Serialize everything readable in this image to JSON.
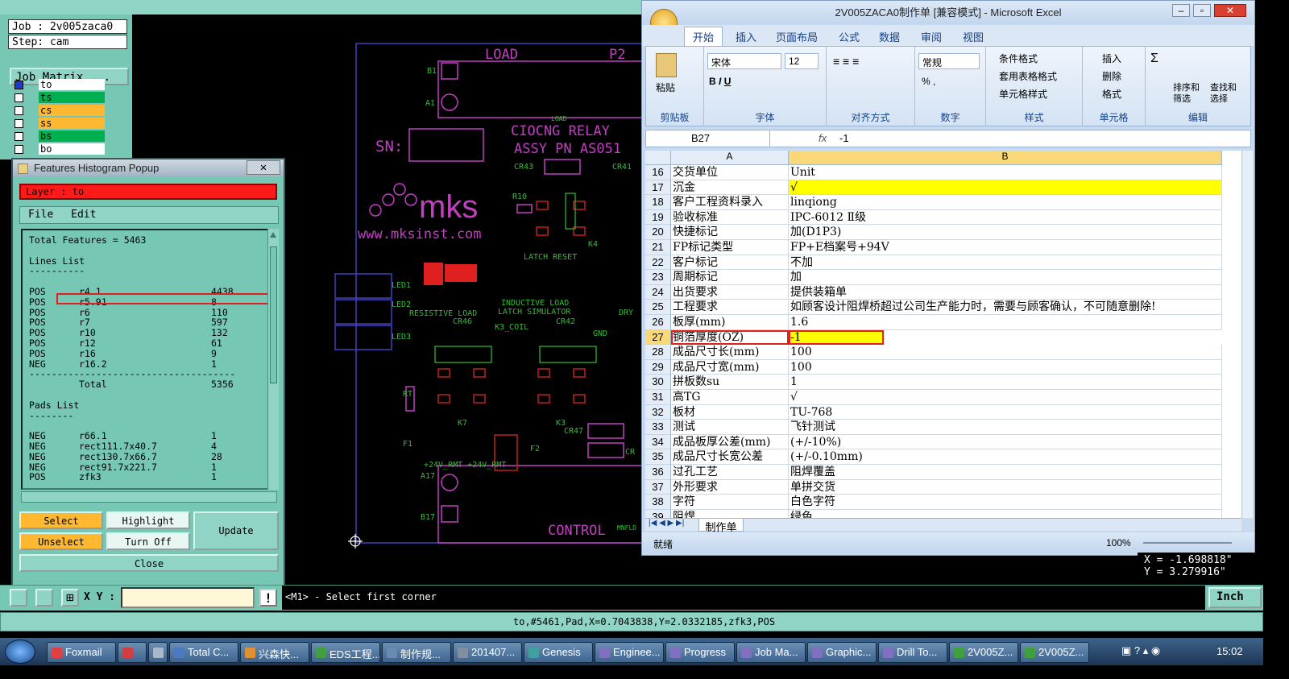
{
  "genesis": {
    "job_label": "Job : 2v005zaca0",
    "step_label": "Step: cam",
    "job_matrix_button": "Job Matrix ...",
    "layers": [
      {
        "name": "to",
        "color": "#ffffff",
        "active": true
      },
      {
        "name": "ts",
        "color": "#00b050"
      },
      {
        "name": "cs",
        "color": "#ffb830"
      },
      {
        "name": "ss",
        "color": "#ffb830"
      },
      {
        "name": "bs",
        "color": "#00b050"
      },
      {
        "name": "bo",
        "color": "#ffffff"
      }
    ],
    "pcb_text": {
      "load": "LOAD",
      "p2": "P2",
      "b1": "B1",
      "a1": "A1",
      "load_small": "LOAD",
      "relay1": "CIOCNG RELAY",
      "relay2": "ASSY PN AS051",
      "sn": "SN:",
      "cr43": "CR43",
      "cr41": "CR41",
      "r10": "R10",
      "k4": "K4",
      "latch_reset": "LATCH RESET",
      "mks": "mks",
      "url": "www.mksinst.com",
      "led1": "LED1",
      "led2": "LED2",
      "led3": "LED3",
      "inductive": "INDUCTIVE LOAD",
      "resistive": "RESISTIVE LOAD",
      "latch_sim": "LATCH SIMULATOR",
      "dry": "DRY",
      "cr46": "CR46",
      "k3coil": "K3_COIL",
      "cr42": "CR42",
      "gnd": "GND",
      "k7": "K7",
      "k3": "K3",
      "cr47": "CR47",
      "f1": "F1",
      "f2": "F2",
      "rt": "RT",
      "rmt": "+24V_RMT +24V_RMT",
      "a17": "A17",
      "b17": "B17",
      "control": "CONTROL",
      "mnfld": "MNFLD",
      "cr": "CR"
    },
    "command_prompt": "X Y :",
    "command_message": "<M1> - Select first corner",
    "units_button": "Inch",
    "status_line": "to,#5461,Pad,X=0.7043838,Y=2.0332185,zfk3,POS",
    "coords": {
      "x": "X = -1.698818\"",
      "y": "Y = 3.279916\""
    }
  },
  "histogram": {
    "title": "Features Histogram Popup",
    "layer_label": "Layer :  to",
    "menu": [
      "File",
      "Edit"
    ],
    "total_features": "Total Features = 5463",
    "lines_header": "Lines List",
    "lines": [
      [
        "POS",
        "r4.1",
        "4438"
      ],
      [
        "POS",
        "r5.91",
        "8"
      ],
      [
        "POS",
        "r6",
        "110"
      ],
      [
        "POS",
        "r7",
        "597"
      ],
      [
        "POS",
        "r10",
        "132"
      ],
      [
        "POS",
        "r12",
        "61"
      ],
      [
        "POS",
        "r16",
        "9"
      ],
      [
        "NEG",
        "r16.2",
        "1"
      ]
    ],
    "total_label": "Total",
    "total_value": "5356",
    "pads_header": "Pads List",
    "pads": [
      [
        "NEG",
        "r66.1",
        "1"
      ],
      [
        "NEG",
        "rect111.7x40.7",
        "4"
      ],
      [
        "NEG",
        "rect130.7x66.7",
        "28"
      ],
      [
        "NEG",
        "rect91.7x221.7",
        "1"
      ],
      [
        "POS",
        "zfk3",
        "1"
      ]
    ],
    "buttons": {
      "select": "Select",
      "highlight": "Highlight",
      "update": "Update",
      "unselect": "Unselect",
      "turn_off": "Turn Off",
      "close": "Close"
    }
  },
  "excel": {
    "title": "2V005ZACA0制作单 [兼容模式] - Microsoft Excel",
    "tabs": [
      "开始",
      "插入",
      "页面布局",
      "公式",
      "数据",
      "审阅",
      "视图"
    ],
    "ribbon": {
      "paste": "粘贴",
      "clipboard": "剪贴板",
      "font_name": "宋体",
      "font_size": "12",
      "font_group": "字体",
      "align_group": "对齐方式",
      "number_format": "常规",
      "number_group": "数字",
      "cond_format": "条件格式",
      "table_format": "套用表格格式",
      "cell_style": "单元格样式",
      "style_group": "样式",
      "insert": "插入",
      "delete": "删除",
      "format": "格式",
      "cells_group": "单元格",
      "sort": "排序和筛选",
      "find": "查找和选择",
      "edit_group": "编辑"
    },
    "name_box": "B27",
    "formula": "-1",
    "col_a": "A",
    "col_b": "B",
    "rows": [
      {
        "n": "16",
        "a": "交货单位",
        "b": "Unit"
      },
      {
        "n": "17",
        "a": "沉金",
        "b": "√",
        "hl": true
      },
      {
        "n": "18",
        "a": "客户工程资料录入",
        "b": "linqiong"
      },
      {
        "n": "19",
        "a": "验收标准",
        "b": "IPC-6012 Ⅱ级"
      },
      {
        "n": "20",
        "a": "快捷标记",
        "b": "加(D1P3)"
      },
      {
        "n": "21",
        "a": "FP标记类型",
        "b": "FP+E档案号+94V"
      },
      {
        "n": "22",
        "a": "客户标记",
        "b": "不加"
      },
      {
        "n": "23",
        "a": "周期标记",
        "b": "加"
      },
      {
        "n": "24",
        "a": "出货要求",
        "b": "提供装箱单"
      },
      {
        "n": "25",
        "a": "工程要求",
        "b": "如顾客设计阻焊桥超过公司生产能力时，需要与顾客确认，不可随意删除!"
      },
      {
        "n": "26",
        "a": "板厚(mm)",
        "b": "1.6"
      },
      {
        "n": "27",
        "a": "铜箔厚度(OZ)",
        "b": "-1",
        "hl": true
      },
      {
        "n": "28",
        "a": "成品尺寸长(mm)",
        "b": "100"
      },
      {
        "n": "29",
        "a": "成品尺寸宽(mm)",
        "b": "100"
      },
      {
        "n": "30",
        "a": "拼板数su",
        "b": "1"
      },
      {
        "n": "31",
        "a": "高TG",
        "b": "√"
      },
      {
        "n": "32",
        "a": "板材",
        "b": "TU-768"
      },
      {
        "n": "33",
        "a": "测试",
        "b": "飞针测试"
      },
      {
        "n": "34",
        "a": "成品板厚公差(mm)",
        "b": "(+/-10%)"
      },
      {
        "n": "35",
        "a": "成品尺寸长宽公差",
        "b": "(+/-0.10mm)"
      },
      {
        "n": "36",
        "a": "过孔工艺",
        "b": "阻焊覆盖"
      },
      {
        "n": "37",
        "a": "外形要求",
        "b": "单拼交货"
      },
      {
        "n": "38",
        "a": "字符",
        "b": "白色字符"
      },
      {
        "n": "39",
        "a": "阻焊",
        "b": "绿色"
      }
    ],
    "sheet_tab": "制作单",
    "status_ready": "就绪",
    "zoom": "100%"
  },
  "taskbar": {
    "items": [
      "Foxmail",
      "",
      "",
      "Total C...",
      "兴森快...",
      "EDS工程...",
      "制作规...",
      "201407...",
      "Genesis",
      "Enginee...",
      "Progress",
      "Job Ma...",
      "Graphic...",
      "Drill To...",
      "2V005Z...",
      "2V005Z..."
    ],
    "clock": "15:02"
  }
}
